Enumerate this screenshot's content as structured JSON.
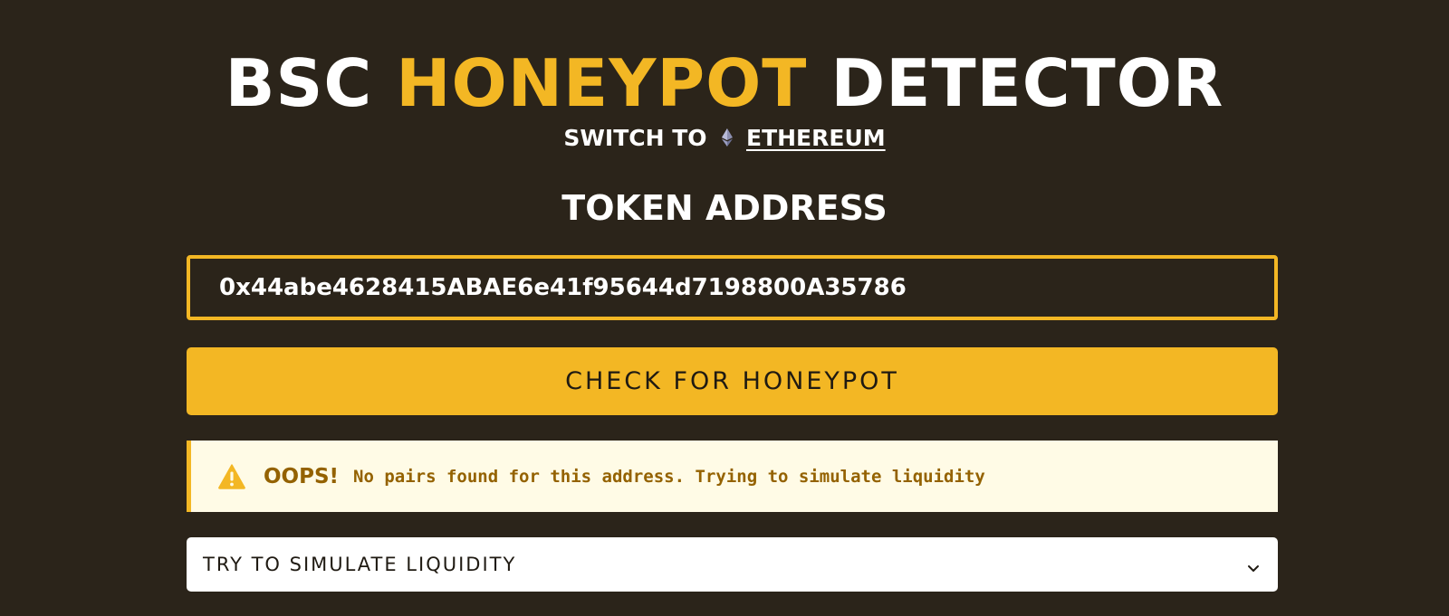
{
  "header": {
    "title_part1": "BSC ",
    "title_accent": "HONEYPOT",
    "title_part2": " DETECTOR",
    "switch_prefix": "SWITCH TO",
    "switch_link": "ETHEREUM"
  },
  "form": {
    "label": "TOKEN ADDRESS",
    "address_value": "0x44abe4628415ABAE6e41f95644d7198800A35786",
    "check_button_label": "CHECK FOR HONEYPOT"
  },
  "alert": {
    "icon": "warning-icon",
    "title": "OOPS!",
    "message": "No pairs found for this address. Trying to simulate liquidity"
  },
  "simulate": {
    "label": "TRY TO SIMULATE LIQUIDITY",
    "icon": "chevron-down-icon"
  },
  "colors": {
    "background": "#2b241a",
    "accent": "#f3b724",
    "alert_bg": "#fffbe6",
    "alert_text": "#946200"
  }
}
